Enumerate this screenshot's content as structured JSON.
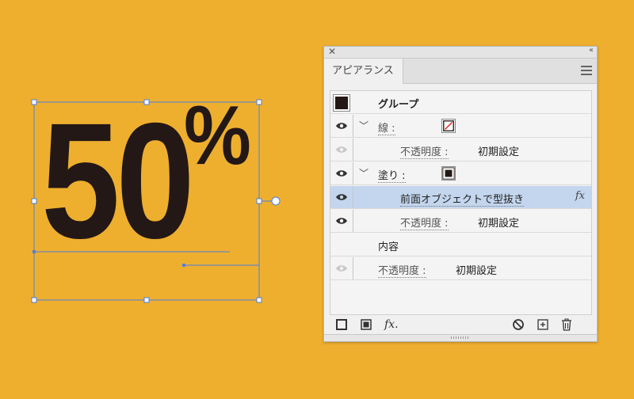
{
  "artwork": {
    "number_text": "50",
    "percent_text": "%"
  },
  "panel": {
    "close_glyph": "✕",
    "collapse_glyph": "‹‹",
    "tab_label": "アピアランス",
    "menu_icon": "hamburger-menu-icon",
    "rows": {
      "group": {
        "label": "グループ"
      },
      "stroke": {
        "label": "線 :"
      },
      "stroke_opacity": {
        "label": "不透明度 :",
        "value": "初期設定"
      },
      "fill": {
        "label": "塗り :"
      },
      "effect": {
        "label": "前面オブジェクトで型抜き",
        "fx": "fx"
      },
      "fill_opacity": {
        "label": "不透明度 :",
        "value": "初期設定"
      },
      "contents": {
        "label": "内容"
      },
      "group_opacity": {
        "label": "不透明度 :",
        "value": "初期設定"
      }
    },
    "footer": {
      "fx_label": "fx.",
      "icons": [
        "add-stroke-icon",
        "add-fill-icon",
        "add-effect-icon",
        "clear-appearance-icon",
        "duplicate-item-icon",
        "delete-icon"
      ]
    }
  },
  "colors": {
    "background": "#EEAF2F",
    "artwork": "#231815",
    "selection": "#4F7FDB",
    "selected_row": "#C3D6EE"
  }
}
